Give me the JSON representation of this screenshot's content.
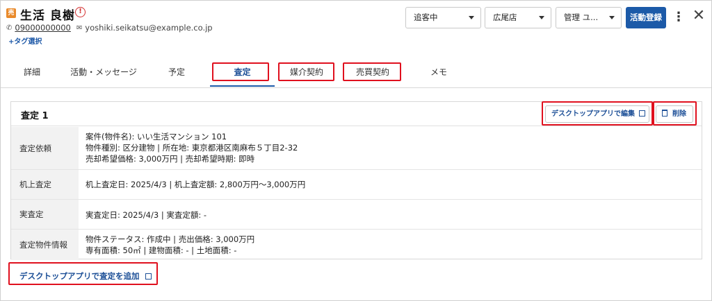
{
  "header": {
    "badge": "売",
    "name": "生活 良樹",
    "alert": "!",
    "phone": "09000000000",
    "email": "yoshiki.seikatsu@example.co.jp",
    "tag_select": "+タグ選択",
    "status_select": "追客中",
    "store_select": "広尾店",
    "manager_select": "管理 ユ...",
    "activity_button": "活動登録",
    "more": "⋮",
    "close": "✕"
  },
  "tabs": [
    "詳細",
    "活動・メッセージ",
    "予定",
    "査定",
    "媒介契約",
    "売買契約",
    "メモ"
  ],
  "active_tab": "査定",
  "highlight_color": "#e0101e",
  "accent_color": "#1c5aa8",
  "card": {
    "title": "査定 1",
    "edit_button": "デスクトップアプリで編集",
    "delete_button": "削除",
    "rows": [
      {
        "label": "査定依頼",
        "lines": [
          "案件(物件名): いい生活マンション 101",
          "物件種別: 区分建物 | 所在地: 東京都港区南麻布５丁目2-32",
          "売却希望価格: 3,000万円 | 売却希望時期: 即時"
        ]
      },
      {
        "label": "机上査定",
        "lines": [
          "机上査定日: 2025/4/3 | 机上査定額: 2,800万円〜3,000万円"
        ]
      },
      {
        "label": "実査定",
        "lines": [
          "実査定日: 2025/4/3 | 実査定額: -"
        ]
      },
      {
        "label": "査定物件情報",
        "lines": [
          "物件ステータス: 作成中 | 売出価格: 3,000万円",
          "専有面積: 50㎡ | 建物面積: - | 土地面積: -"
        ]
      }
    ]
  },
  "add_link": "デスクトップアプリで査定を追加"
}
